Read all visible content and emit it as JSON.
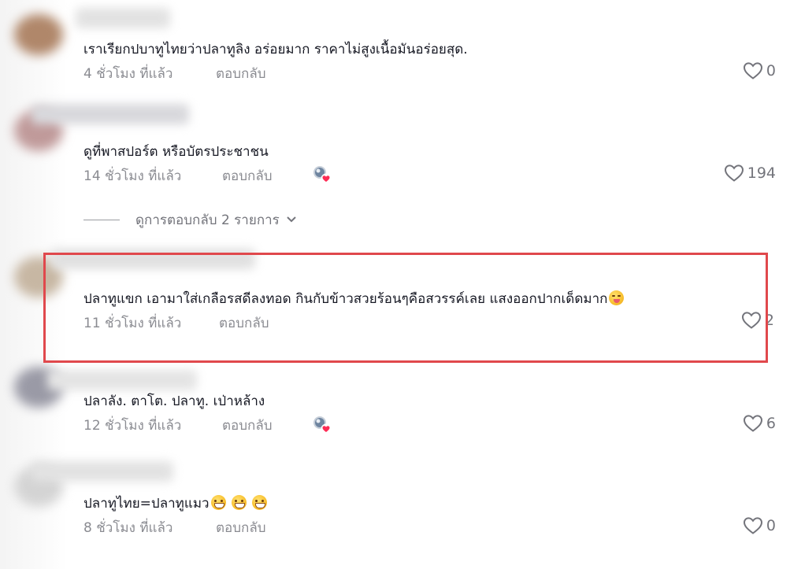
{
  "comments": [
    {
      "text": "เราเรียกปบาทูไทยว่าปลาทูลิง อร่อยมาก ราคาไม่สูงเนื้อมันอร่อยสุด.",
      "time": "4 ชั่วโมง ที่แล้ว",
      "reply": "ตอบกลับ",
      "likes": "0",
      "creator_liked": false
    },
    {
      "text": "ดูที่พาสปอร์ต หรือบัตรประชาชน",
      "time": "14 ชั่วโมง ที่แล้ว",
      "reply": "ตอบกลับ",
      "likes": "194",
      "creator_liked": true
    },
    {
      "text": "ปลาทูแขก เอามาใส่เกลือรสดีลงทอด กินกับข้าวสวยร้อนๆคือสวรรค์เลย แสงออกปากเด็ดมาก",
      "time": "11 ชั่วโมง ที่แล้ว",
      "reply": "ตอบกลับ",
      "likes": "2",
      "creator_liked": false,
      "highlighted": true
    },
    {
      "text": "ปลาลัง. ตาโต. ปลาทู. เป่าหล้าง",
      "time": "12 ชั่วโมง ที่แล้ว",
      "reply": "ตอบกลับ",
      "likes": "6",
      "creator_liked": true
    },
    {
      "text": "ปลาทูไทย=ปลาทูแมว",
      "time": "8 ชั่วโมง ที่แล้ว",
      "reply": "ตอบกลับ",
      "likes": "0",
      "creator_liked": false
    }
  ],
  "view_replies": "ดูการตอบกลับ 2 รายการ",
  "icons": {
    "like": "heart-outline-icon",
    "creator_liked": "creator-liked-heart-icon",
    "expand": "chevron-down-icon",
    "emoji_yum": "face-savoring-food-emoji",
    "emoji_grin": "grinning-face-emoji"
  },
  "colors": {
    "highlight_border": "#e0484c",
    "text_primary": "#161823",
    "text_secondary": "#8a8b91",
    "creator_heart": "#fe2c55"
  }
}
